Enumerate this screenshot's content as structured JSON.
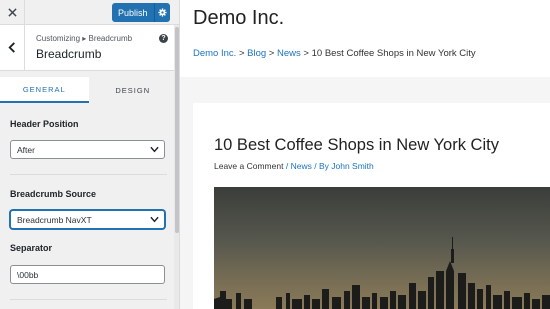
{
  "customizer": {
    "publish_label": "Publish",
    "section_path": "Customizing ▸ Breadcrumb",
    "section_title": "Breadcrumb",
    "tabs": [
      {
        "label": "GENERAL",
        "active": true
      },
      {
        "label": "DESIGN",
        "active": false
      }
    ],
    "fields": {
      "header_position": {
        "label": "Header Position",
        "value": "After"
      },
      "breadcrumb_source": {
        "label": "Breadcrumb Source",
        "value": "Breadcrumb NavXT"
      },
      "separator": {
        "label": "Separator",
        "value": "\\00bb"
      }
    },
    "colors": {
      "accent": "#2271b1",
      "link": "#1e73be"
    }
  },
  "site": {
    "title": "Demo Inc.",
    "breadcrumb": {
      "items": [
        "Demo Inc.",
        "Blog",
        "News"
      ],
      "separator": ">",
      "current": "10 Best Coffee Shops in New York City"
    },
    "post": {
      "title": "10 Best Coffee Shops in New York City",
      "comment_link": "Leave a Comment",
      "meta_sep_1": "/",
      "category": "News",
      "meta_sep_2": "/ By",
      "author": "John Smith"
    }
  }
}
